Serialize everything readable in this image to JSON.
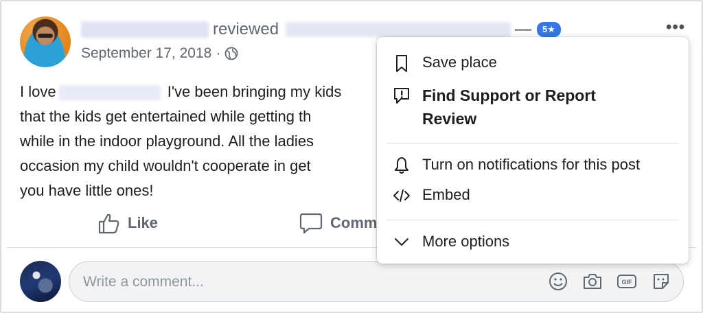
{
  "post": {
    "reviewed_label": "reviewed",
    "dash": "—",
    "rating": "5★",
    "date": "September 17, 2018",
    "date_separator": "·",
    "more_icon": "•••",
    "text_lines": [
      {
        "pre": "I love",
        "post": " I've been bringing my kids"
      },
      {
        "text": "that the kids get entertained while getting th"
      },
      {
        "text": "while in the indoor playground. All the ladies"
      },
      {
        "text": "occasion my child wouldn't cooperate in get"
      },
      {
        "text": "you have little ones!"
      }
    ]
  },
  "actions": {
    "like_label": "Like",
    "comment_label": "Comm"
  },
  "comment": {
    "placeholder": "Write a comment..."
  },
  "menu": {
    "save_place": "Save place",
    "find_support": "Find Support or Report",
    "find_support_line2": "Review",
    "notifications": "Turn on notifications for this post",
    "embed": "Embed",
    "more_options": "More options"
  },
  "icons": [
    "globe-icon",
    "more-icon",
    "thumbs-up-icon",
    "comment-icon",
    "emoji-icon",
    "camera-icon",
    "gif-icon",
    "sticker-icon",
    "bookmark-icon",
    "report-icon",
    "bell-icon",
    "code-icon",
    "chevron-down-icon"
  ],
  "colors": {
    "rating_badge": "#3578e5",
    "secondary_text": "#606770",
    "primary_text": "#1c1e21"
  }
}
